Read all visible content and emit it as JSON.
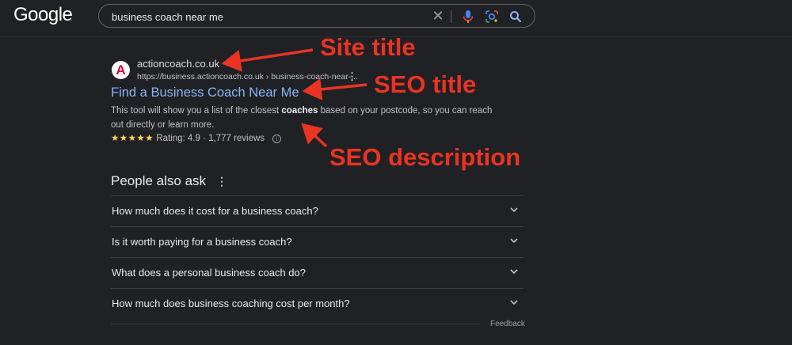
{
  "header": {
    "logo": "Google",
    "search_value": "business coach near me"
  },
  "result": {
    "favicon_letter": "A",
    "site_name": "actioncoach.co.uk",
    "site_url": "https://business.actioncoach.co.uk › business-coach-near-...",
    "title": "Find a Business Coach Near Me",
    "snippet_before": "This tool will show you a list of the closest ",
    "snippet_bold": "coaches",
    "snippet_after": " based on your postcode, so you can reach out directly or learn more.",
    "stars": "★★★★★",
    "rating": "Rating: 4.9 · 1,777 reviews"
  },
  "people_also_ask": {
    "title": "People also ask",
    "questions": [
      "How much does it cost for a business coach?",
      "Is it worth paying for a business coach?",
      "What does a personal business coach do?",
      "How much does business coaching cost per month?"
    ],
    "feedback": "Feedback"
  },
  "annotations": {
    "site_title": "Site title",
    "seo_title": "SEO title",
    "seo_description": "SEO description",
    "color": "#ea3323"
  },
  "colors": {
    "background": "#202124",
    "link": "#8ab4f8",
    "star": "#fdd663"
  }
}
